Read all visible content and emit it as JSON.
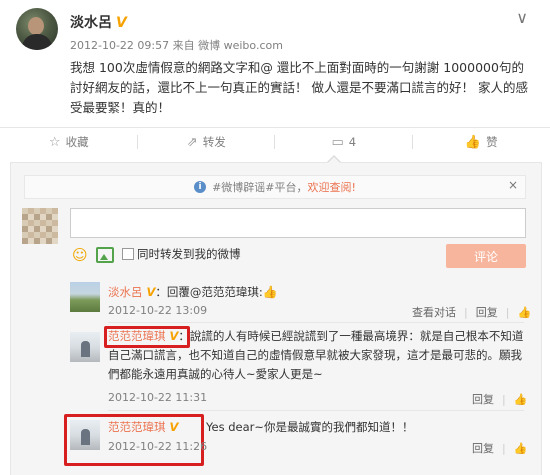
{
  "post": {
    "username": "淡水呂",
    "verified_badge": "V",
    "meta": "2012-10-22 09:57 来自 微博 weibo.com",
    "text": "我想 100次虛情假意的網路文字和@ 還比不上面對面時的一句謝謝 1000000句的討好網友的話，還比不上一句真正的實話！ 做人還是不要滿口謊言的好！ 家人的感受最要緊！真的！",
    "chevron": "∨"
  },
  "actions": {
    "favorite": {
      "icon": "star-icon",
      "label": "收藏"
    },
    "repost": {
      "icon": "share-icon",
      "label": "转发"
    },
    "comment": {
      "icon": "comment-icon",
      "label": "4"
    },
    "like": {
      "icon": "thumb-up-icon",
      "label": "赞"
    }
  },
  "comment_box": {
    "notice_prefix": "#微博辟谣#平台，",
    "notice_link": "欢迎查阅!",
    "notice_close": "×",
    "input_value": "",
    "checkbox_label": "同时转发到我的微博",
    "submit_label": "评论"
  },
  "comments": [
    {
      "name": "淡水呂",
      "badge": "V",
      "text": "：回覆@范范范瑋琪:",
      "time": "2012-10-22 13:09",
      "actions": [
        "查看对话",
        "回复"
      ]
    },
    {
      "name": "范范范瑋琪",
      "badge": "V",
      "text": "：說謊的人有時候已經說謊到了一種最高境界：就是自己根本不知道自己滿口謊言，也不知道自己的虛情假意早就被大家發現，這才是最可悲的。願我們都能永遠用真誠的心待人~愛家人更是~",
      "time": "2012-10-22 11:31",
      "actions": [
        "回复"
      ]
    },
    {
      "name": "范范范瑋琪",
      "badge": "V",
      "text": "Yes dear~你是最誠實的我們都知道！！",
      "time": "2012-10-22 11:26",
      "actions": [
        "回复"
      ]
    }
  ],
  "colors": {
    "accent": "#eb7350",
    "highlight_box": "#d71f1f",
    "badge": "#f6a200"
  }
}
